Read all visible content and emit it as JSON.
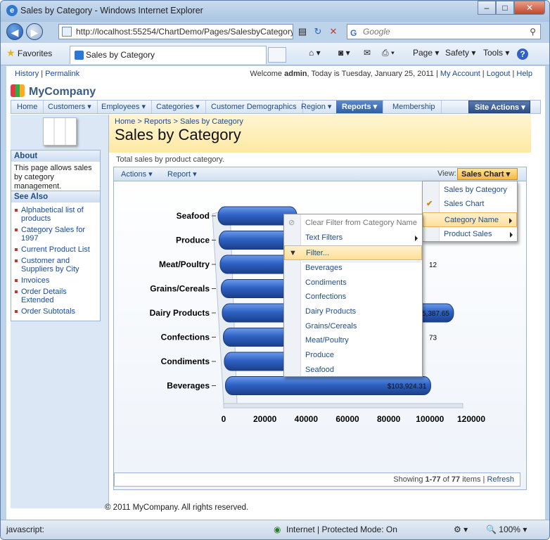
{
  "window": {
    "title": "Sales by Category - Windows Internet Explorer",
    "min": "–",
    "max": "□",
    "close": "✕"
  },
  "browser": {
    "address": "http://localhost:55254/ChartDemo/Pages/SalesbyCategory",
    "search_placeholder": "Google",
    "favorites": "Favorites",
    "tab_title": "Sales by Category",
    "cmd": [
      "Page",
      "Safety",
      "Tools"
    ]
  },
  "page": {
    "history": "History",
    "permalink": "Permalink",
    "welcome": "Welcome",
    "user": "admin",
    "today": ", Today is Tuesday, January 25, 2011 |",
    "my_account": "My Account",
    "logout": "Logout",
    "help": "Help",
    "brand": "MyCompany",
    "menu": [
      "Home",
      "Customers ▾",
      "Employees ▾",
      "Categories ▾",
      "Customer Demographics",
      "Region ▾",
      "Reports ▾",
      "Membership"
    ],
    "site_actions": "Site Actions ▾",
    "breadcrumb": [
      "Home",
      "Reports",
      "Sales by Category"
    ],
    "breadcrumb_sep": ">",
    "title": "Sales by Category",
    "description": "Total sales by product category.",
    "about": {
      "title": "About",
      "text": "This page allows sales by category management."
    },
    "see_also": {
      "title": "See Also",
      "items": [
        "Alphabetical list of products",
        "Category Sales for 1997",
        "Current Product List",
        "Customer and Suppliers by City",
        "Invoices",
        "Order Details Extended",
        "Order Subtotals"
      ]
    },
    "toolbar": {
      "actions": "Actions ▾",
      "report": "Report ▾",
      "view_label": "View:",
      "view_value": "Sales Chart ▾"
    },
    "pager": {
      "showing": "Showing",
      "range": "1-77",
      "of": "of",
      "total": "77",
      "items": "items |",
      "refresh": "Refresh"
    },
    "footer": "© 2011 MyCompany. All rights reserved."
  },
  "view_menu": {
    "items": [
      "Sales by Category",
      "Sales Chart",
      "Category Name",
      "Product Sales"
    ],
    "checked": "Sales Chart",
    "highlighted": "Category Name"
  },
  "filter_menu": {
    "clear": "Clear Filter from Category Name",
    "text_filters": "Text Filters",
    "filter": "Filter...",
    "values": [
      "Beverages",
      "Condiments",
      "Confections",
      "Dairy Products",
      "Grains/Cereals",
      "Meat/Poultry",
      "Produce",
      "Seafood"
    ]
  },
  "status": {
    "left": "javascript:",
    "zone": "Internet | Protected Mode: On",
    "zoom": "100%"
  },
  "chart_data": {
    "type": "bar",
    "orientation": "horizontal",
    "categories": [
      "Seafood",
      "Produce",
      "Meat/Poultry",
      "Grains/Cereals",
      "Dairy Products",
      "Confections",
      "Condiments",
      "Beverages"
    ],
    "values": [
      null,
      null,
      null,
      null,
      115387.65,
      null,
      55368.6,
      103924.31
    ],
    "data_labels": [
      "",
      "",
      "",
      "",
      "$115,387.65",
      "",
      "$55,368.60",
      "$103,924.31"
    ],
    "xlim": [
      0,
      120000
    ],
    "xticks": [
      "0",
      "20000",
      "40000",
      "60000",
      "80000",
      "100000",
      "120000"
    ],
    "partial_labels": {
      "Meat/Poultry": "12",
      "Confections": "73"
    },
    "bar_color": "#2f62c4"
  }
}
